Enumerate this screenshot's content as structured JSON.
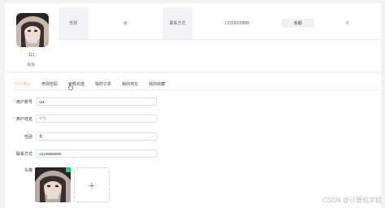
{
  "profile": {
    "id": "111",
    "nickname": "兔兔"
  },
  "info": {
    "gender_label": "性别",
    "gender_value": "女",
    "phone_label": "联系方式",
    "phone_value": "13199999888",
    "balance_button": "余额",
    "balance_value": "0"
  },
  "tabs": [
    {
      "label": "个人中心",
      "active": true
    },
    {
      "label": "修改密码",
      "active": false
    },
    {
      "label": "余额充值",
      "active": false
    },
    {
      "label": "我的订单",
      "active": false
    },
    {
      "label": "我的地址",
      "active": false
    },
    {
      "label": "我的收藏",
      "active": false
    }
  ],
  "form": {
    "account_label": "用户账号",
    "account_value": "111",
    "name_label": "用户姓名",
    "name_value": "兔兔",
    "gender_label": "性别",
    "gender_value": "女",
    "phone_label": "联系方式",
    "phone_value": "13199999888",
    "avatar_label": "头像"
  },
  "watermark": "CSDN @计算机学姐"
}
